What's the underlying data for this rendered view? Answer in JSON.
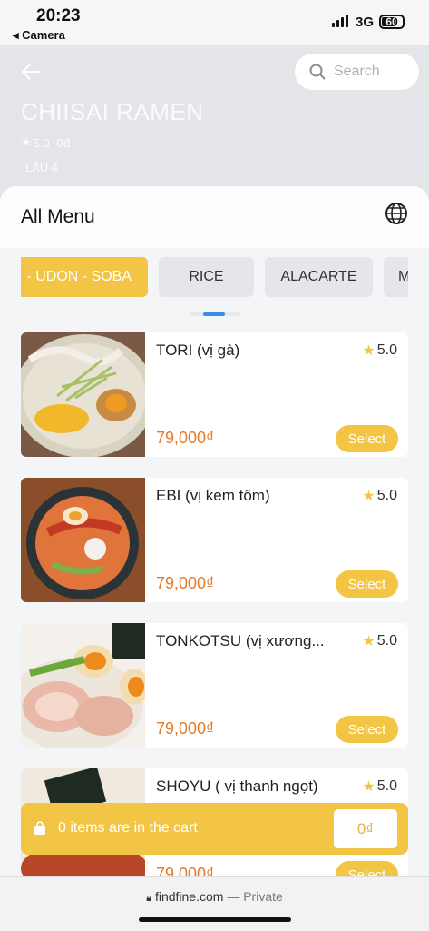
{
  "status": {
    "time": "20:23",
    "back_app": "◂ Camera",
    "network": "3G",
    "battery": "60"
  },
  "header": {
    "search_placeholder": "Search",
    "shop_name": "CHIISAI RAMEN",
    "rating": "5.0",
    "reviews": "0đ",
    "floor": "LẦU 4"
  },
  "menu": {
    "title": "All Menu",
    "tabs": [
      {
        "label": "- UDON - SOBA",
        "active": true
      },
      {
        "label": "RICE",
        "active": false
      },
      {
        "label": "ALACARTE",
        "active": false
      },
      {
        "label": "M",
        "active": false
      }
    ]
  },
  "items": [
    {
      "name": "TORI (vị gà)",
      "rating": "5.0",
      "price": "79,000₫",
      "select_label": "Select"
    },
    {
      "name": "EBI (vị kem tôm)",
      "rating": "5.0",
      "price": "79,000₫",
      "select_label": "Select"
    },
    {
      "name": "TONKOTSU (vị xương...",
      "rating": "5.0",
      "price": "79,000₫",
      "select_label": "Select"
    },
    {
      "name": "SHOYU ( vị thanh ngọt)",
      "rating": "5.0",
      "price": "79,000₫",
      "select_label": "Select"
    }
  ],
  "cart": {
    "message": "0 items are in the cart",
    "total": "0₫"
  },
  "browser": {
    "domain": "findfine.com",
    "mode": "— Private"
  },
  "colors": {
    "accent": "#f2c545",
    "price": "#e57a2a",
    "scroll_thumb": "#3c8ce7"
  }
}
